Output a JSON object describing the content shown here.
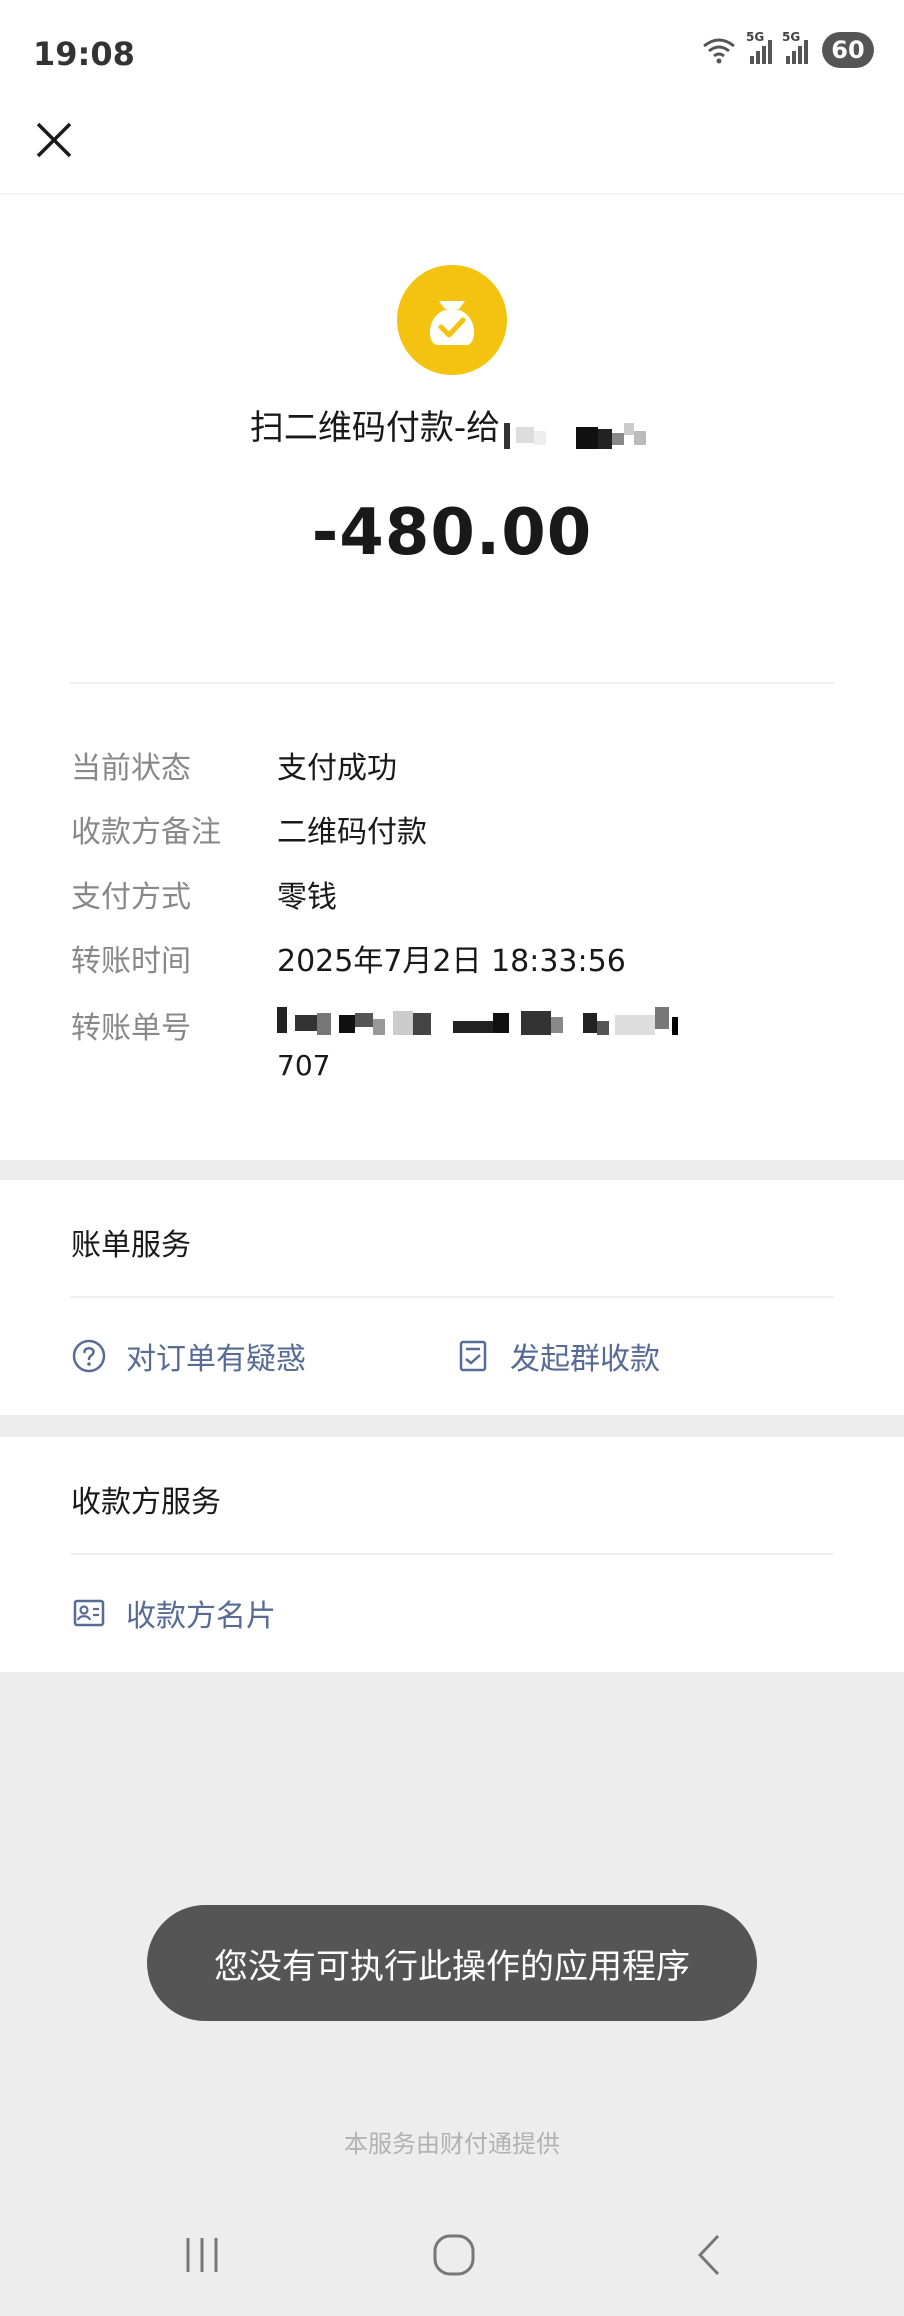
{
  "status_bar": {
    "time": "19:08",
    "battery": "60",
    "sim1": "5G",
    "sim2": "5G"
  },
  "transaction": {
    "title": "扫二维码付款-给",
    "amount": "-480.00"
  },
  "details": [
    {
      "label": "当前状态",
      "value": "支付成功"
    },
    {
      "label": "收款方备注",
      "value": "二维码付款"
    },
    {
      "label": "支付方式",
      "value": "零钱"
    },
    {
      "label": "转账时间",
      "value": "2025年7月2日 18:33:56"
    },
    {
      "label": "转账单号",
      "value": ""
    }
  ],
  "bill_service": {
    "title": "账单服务",
    "doubt_label": "对订单有疑惑",
    "group_collect_label": "发起群收款"
  },
  "payee_service": {
    "title": "收款方服务",
    "card_label": "收款方名片"
  },
  "toast": "您没有可执行此操作的应用程序",
  "footer": "本服务由财付通提供",
  "icons": {
    "close": "close-icon",
    "money": "money-bag-icon",
    "question": "question-circle-icon",
    "collect": "receipt-icon",
    "card": "contact-card-icon"
  },
  "colors": {
    "accent_link": "#576b95",
    "money_icon": "#f4c30f",
    "toast_bg": "#555555"
  }
}
